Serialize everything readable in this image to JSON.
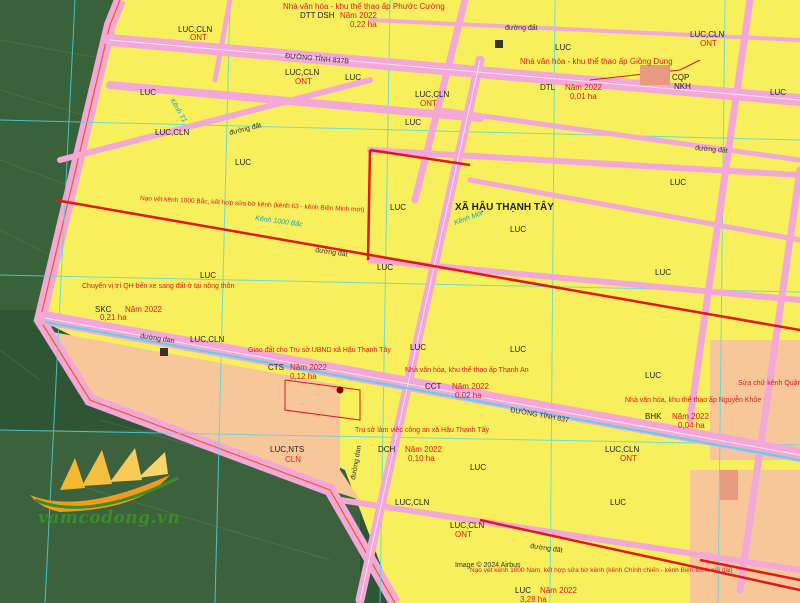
{
  "commune_label": "XÃ HẬU THẠNH TÂY",
  "roads": {
    "dt837b": "ĐƯỜNG TỈNH 837B",
    "dt837": "ĐƯỜNG TỈNH 837",
    "duong_dat": "đường đất",
    "duong_dan": "đường dan",
    "duong_dal": "đường đal"
  },
  "canals": {
    "kenh_1000_bac": "Kênh 1000 Bắc",
    "kenh_t1": "Kênh T1",
    "kenh_moi": "Kênh Mới"
  },
  "land_codes": {
    "luc": "LUC",
    "luc_cln": "LUC,CLN",
    "luc_nts": "LUC,NTS",
    "cln": "CLN",
    "ont": "ONT",
    "cqp": "CQP",
    "nkh": "NKH"
  },
  "projects": [
    {
      "name": "Nhà văn hóa - khu thể thao ấp Phước Cường",
      "code": "DTT DSH",
      "year": "Năm 2022",
      "area": "0,22 ha"
    },
    {
      "name": "Nhà văn hóa - khu thể thao ấp Giồng Dung",
      "code": "DTL",
      "year": "Năm 2022",
      "area": "0,01 ha"
    },
    {
      "name": "Nạo vét kênh 1000 Bắc, kết hợp sửa bờ kênh (kênh 63 - kênh Biện Minh mới)",
      "code": "",
      "year": "",
      "area": ""
    },
    {
      "name": "Chuyển vị trí QH bến xe sang đất ở tại nông thôn",
      "code": "SKC",
      "year": "Năm 2022",
      "area": "0,21 ha"
    },
    {
      "name": "Giao đất cho Trụ sở UBND xã Hậu Thạnh Tây",
      "code": "CTS",
      "year": "Năm 2022",
      "area": "0,12 ha"
    },
    {
      "name": "Nhà văn hóa, khu thể thao ấp Thanh An",
      "code": "CCT",
      "year": "Năm 2022",
      "area": "0,02 ha"
    },
    {
      "name": "Nhà văn hóa, khu thể thao ấp Nguyễn Khôe",
      "code": "BHK",
      "year": "Năm 2022",
      "area": "0,04 ha"
    },
    {
      "name": "Trụ sở làm việc công an xã Hậu Thạnh Tây",
      "code": "DCH",
      "year": "Năm 2022",
      "area": "0,10 ha"
    },
    {
      "name": "Nạo vét kênh 1000 Nam, kết hợp sửa bờ kênh (kênh Chính chiến - kênh Biện Minh nối dài)",
      "code": "LUC",
      "year": "Năm 2022",
      "area": "3,28 ha"
    }
  ],
  "edge_note": "Sửa chữ kênh Quận đ",
  "credit": "Image © 2024 Airbus",
  "logo_text": "vamcodong.vn",
  "colors": {
    "rice": "#f7ef5c",
    "road": "#f3a8d8",
    "orange_zone": "#f7c79a",
    "satellite": "#2f5a36",
    "grid": "#4fd8e8",
    "boundary": "#ee5a20"
  }
}
